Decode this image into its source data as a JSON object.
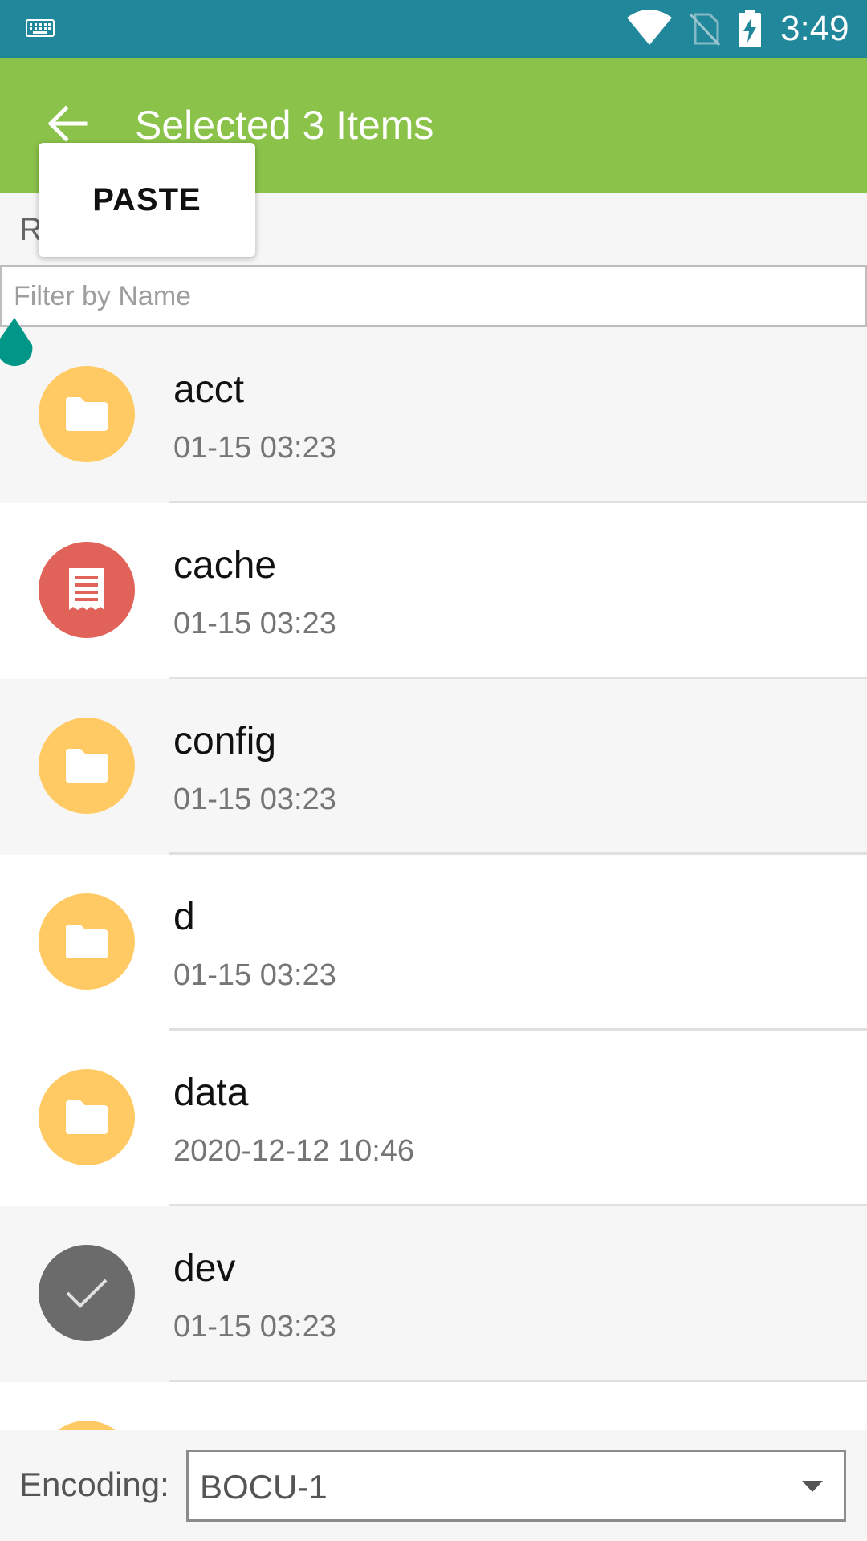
{
  "status_bar": {
    "time": "3:49",
    "icons": [
      "keyboard-icon",
      "wifi-icon",
      "no-sim-icon",
      "battery-charging-icon"
    ]
  },
  "toolbar": {
    "title": "Selected 3 Items",
    "back_icon": "arrow-back-icon"
  },
  "popup_menu": {
    "items": [
      {
        "label": "PASTE"
      }
    ]
  },
  "path_bar": {
    "text": "R"
  },
  "filter": {
    "placeholder": "Filter by Name",
    "value": ""
  },
  "files": [
    {
      "name": "acct",
      "date": "01-15 03:23",
      "icon": "folder-icon",
      "color": "#ffca63",
      "selected": false
    },
    {
      "name": "cache",
      "date": "01-15 03:23",
      "icon": "document-icon",
      "color": "#e06258",
      "selected": false
    },
    {
      "name": "config",
      "date": "01-15 03:23",
      "icon": "folder-icon",
      "color": "#ffca63",
      "selected": false
    },
    {
      "name": "d",
      "date": "01-15 03:23",
      "icon": "folder-icon",
      "color": "#ffca63",
      "selected": false
    },
    {
      "name": "data",
      "date": "2020-12-12 10:46",
      "icon": "folder-icon",
      "color": "#ffca63",
      "selected": false
    },
    {
      "name": "dev",
      "date": "01-15 03:23",
      "icon": "check-icon",
      "color": "#6b6b6b",
      "selected": true
    }
  ],
  "encoding": {
    "label": "Encoding:",
    "value": "BOCU-1",
    "dropdown_icon": "dropdown-arrow-icon"
  },
  "colors": {
    "status_bar": "#21879a",
    "toolbar": "#8bc34a",
    "folder": "#ffca63",
    "document": "#e06258",
    "selected": "#6b6b6b",
    "cursor_handle": "#009688"
  }
}
